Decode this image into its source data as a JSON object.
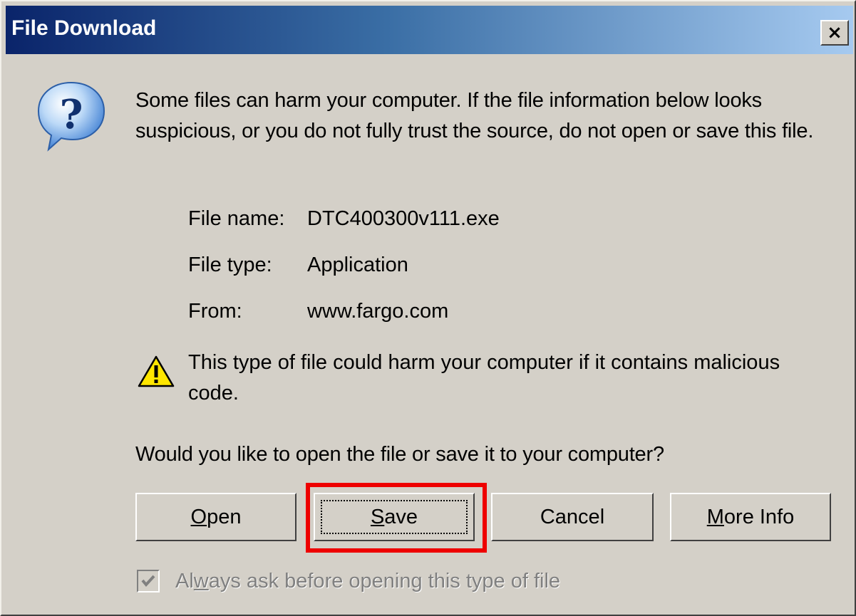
{
  "titlebar": {
    "title": "File Download",
    "close_glyph": "×"
  },
  "message": {
    "warning": "Some files can harm your computer. If the file information below looks suspicious, or you do not fully trust the source, do not open or save this file.",
    "file_name_label": "File name:",
    "file_name_value": "DTC400300v111.exe",
    "file_type_label": "File type:",
    "file_type_value": "Application",
    "from_label": "From:",
    "from_value": "www.fargo.com",
    "harm_warning": "This type of file could harm your computer if it contains malicious code.",
    "question": "Would you like to open the file or save it to your computer?"
  },
  "buttons": {
    "open": {
      "mnemonic": "O",
      "rest": "pen"
    },
    "save": {
      "mnemonic": "S",
      "rest": "ave"
    },
    "cancel": {
      "label": "Cancel"
    },
    "more_info": {
      "mnemonic": "M",
      "rest": "ore Info"
    }
  },
  "checkbox": {
    "label_pre": "Al",
    "label_mnemonic": "w",
    "label_post": "ays ask before opening this type of file",
    "checked": true
  },
  "icons": {
    "dialog": "question-icon",
    "warning": "warning-shield-icon",
    "close": "close-icon"
  },
  "colors": {
    "title_gradient_start": "#0a246a",
    "title_gradient_end": "#a6caf0",
    "dialog_face": "#d4d0c8",
    "highlight": "#ee0000"
  }
}
